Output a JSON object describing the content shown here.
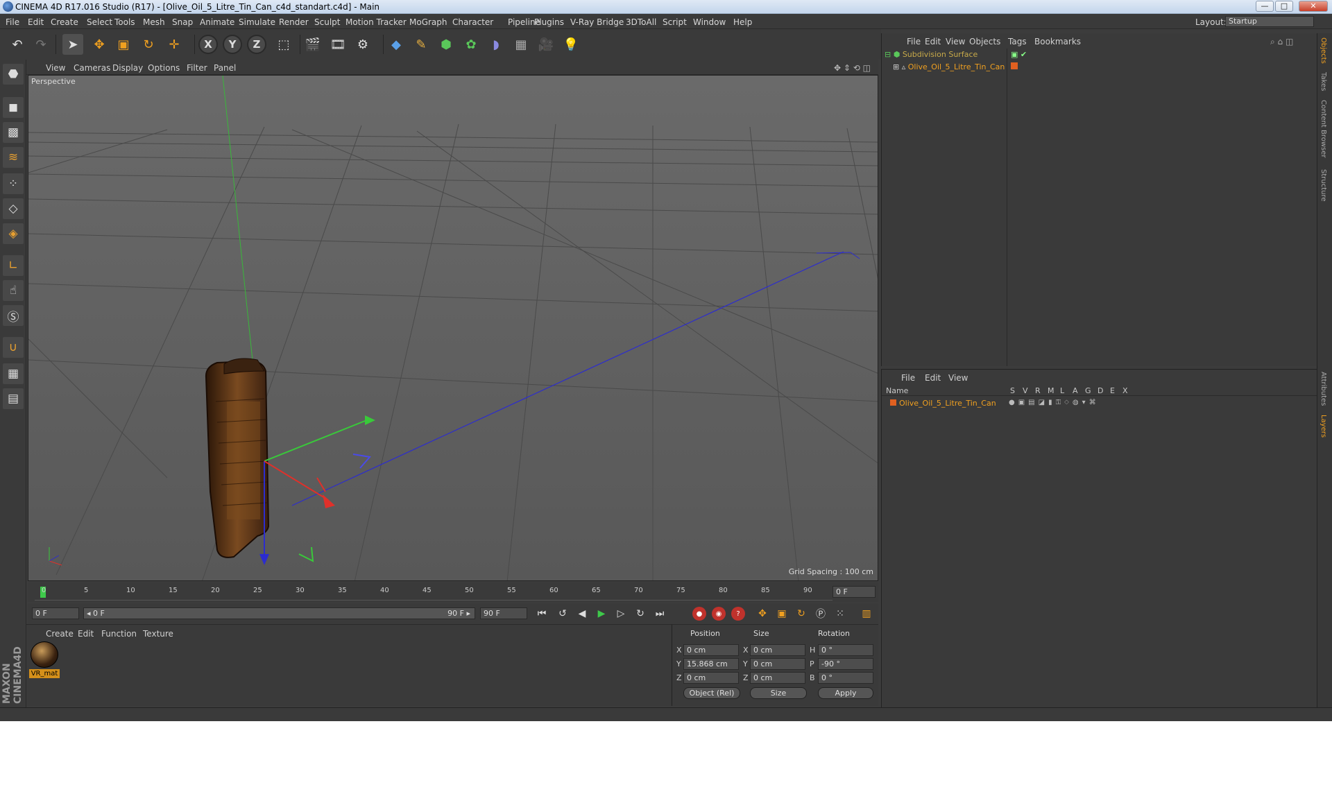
{
  "window": {
    "title": "CINEMA 4D R17.016 Studio (R17) - [Olive_Oil_5_Litre_Tin_Can_c4d_standart.c4d] - Main",
    "min": "—",
    "max": "□",
    "close": "✕"
  },
  "menubar": {
    "items": [
      "File",
      "Edit",
      "Create",
      "Select",
      "Tools",
      "Mesh",
      "Snap",
      "Animate",
      "Simulate",
      "Render",
      "Sculpt",
      "Motion Tracker",
      "MoGraph",
      "Character",
      "Pipeline",
      "Plugins",
      "V-Ray Bridge",
      "3DToAll",
      "Script",
      "Window",
      "Help"
    ],
    "layout_label": "Layout:",
    "layout_value": "Startup"
  },
  "toolbar": {
    "undo": "↶",
    "redo": "↷",
    "x": "X",
    "y": "Y",
    "z": "Z"
  },
  "viewport": {
    "menu": [
      "View",
      "Cameras",
      "Display",
      "Options",
      "Filter",
      "Panel"
    ],
    "label": "Perspective",
    "grid_spacing": "Grid Spacing : 100 cm"
  },
  "timeline": {
    "ticks": [
      "0",
      "5",
      "10",
      "15",
      "20",
      "25",
      "30",
      "35",
      "40",
      "45",
      "50",
      "55",
      "60",
      "65",
      "70",
      "75",
      "80",
      "85",
      "90"
    ],
    "current": "0 F",
    "start": "0 F",
    "range_start": "◂ 0 F",
    "range_end": "90 F ▸",
    "end": "90 F",
    "end_field": "90 F"
  },
  "material": {
    "menu": [
      "Create",
      "Edit",
      "Function",
      "Texture"
    ],
    "name": "VR_mat"
  },
  "coords": {
    "headers": [
      "Position",
      "Size",
      "Rotation"
    ],
    "pos": {
      "x": "0 cm",
      "y": "15.868 cm",
      "z": "0 cm"
    },
    "size": {
      "x": "0 cm",
      "y": "0 cm",
      "z": "0 cm"
    },
    "rot": {
      "h": "0 °",
      "p": "-90 °",
      "b": "0 °"
    },
    "labels": {
      "x": "X",
      "y": "Y",
      "z": "Z",
      "h": "H",
      "p": "P",
      "b": "B"
    },
    "mode": "Object (Rel)",
    "size_mode": "Size",
    "apply": "Apply"
  },
  "objects": {
    "menu": [
      "File",
      "Edit",
      "View",
      "Objects",
      "Tags",
      "Bookmarks"
    ],
    "items": [
      "Subdivision Surface",
      "Olive_Oil_5_Litre_Tin_Can"
    ]
  },
  "layers": {
    "menu": [
      "File",
      "Edit",
      "View"
    ],
    "name_header": "Name",
    "cols": [
      "S",
      "V",
      "R",
      "M",
      "L",
      "A",
      "G",
      "D",
      "E",
      "X"
    ],
    "item": "Olive_Oil_5_Litre_Tin_Can"
  },
  "sidetabs": [
    "Objects",
    "Takes",
    "Content Browser",
    "Structure",
    "Attributes",
    "Layers"
  ],
  "brand": {
    "maxon": "MAXON CINEMA4D"
  },
  "colors": {
    "accent": "#d5901a",
    "play": "#3ec94a",
    "x_axis": "#e0302a",
    "y_axis": "#39c93a",
    "z_axis": "#3b3bd8"
  }
}
